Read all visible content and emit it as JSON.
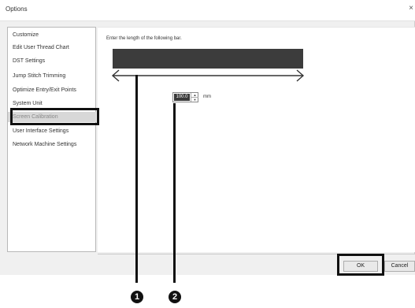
{
  "window": {
    "title": "Options",
    "close_glyph": "×"
  },
  "sidebar": {
    "items": [
      {
        "label": "Customize",
        "selected": false
      },
      {
        "label": "Edit User Thread Chart",
        "selected": false
      },
      {
        "label": "DST Settings",
        "selected": false
      },
      {
        "label": "Jump Stitch Trimming",
        "selected": false
      },
      {
        "label": "Optimize Entry/Exit Points",
        "selected": false
      },
      {
        "label": "System Unit",
        "selected": false
      },
      {
        "label": "Screen Calibration",
        "selected": true
      },
      {
        "label": "User Interface Settings",
        "selected": false
      },
      {
        "label": "Network Machine Settings",
        "selected": false
      }
    ]
  },
  "content": {
    "instruction": "Enter the length of the following bar.",
    "length_value": "100.0",
    "unit": "mm",
    "spin_up_icon": "▲",
    "spin_down_icon": "▼"
  },
  "buttons": {
    "ok": "OK",
    "cancel": "Cancel"
  },
  "callouts": {
    "marker_1": "1",
    "marker_2": "2"
  },
  "colors": {
    "bar": "#3c3c3c",
    "callout": "#111111",
    "selected_bg": "#d8d8d8"
  }
}
